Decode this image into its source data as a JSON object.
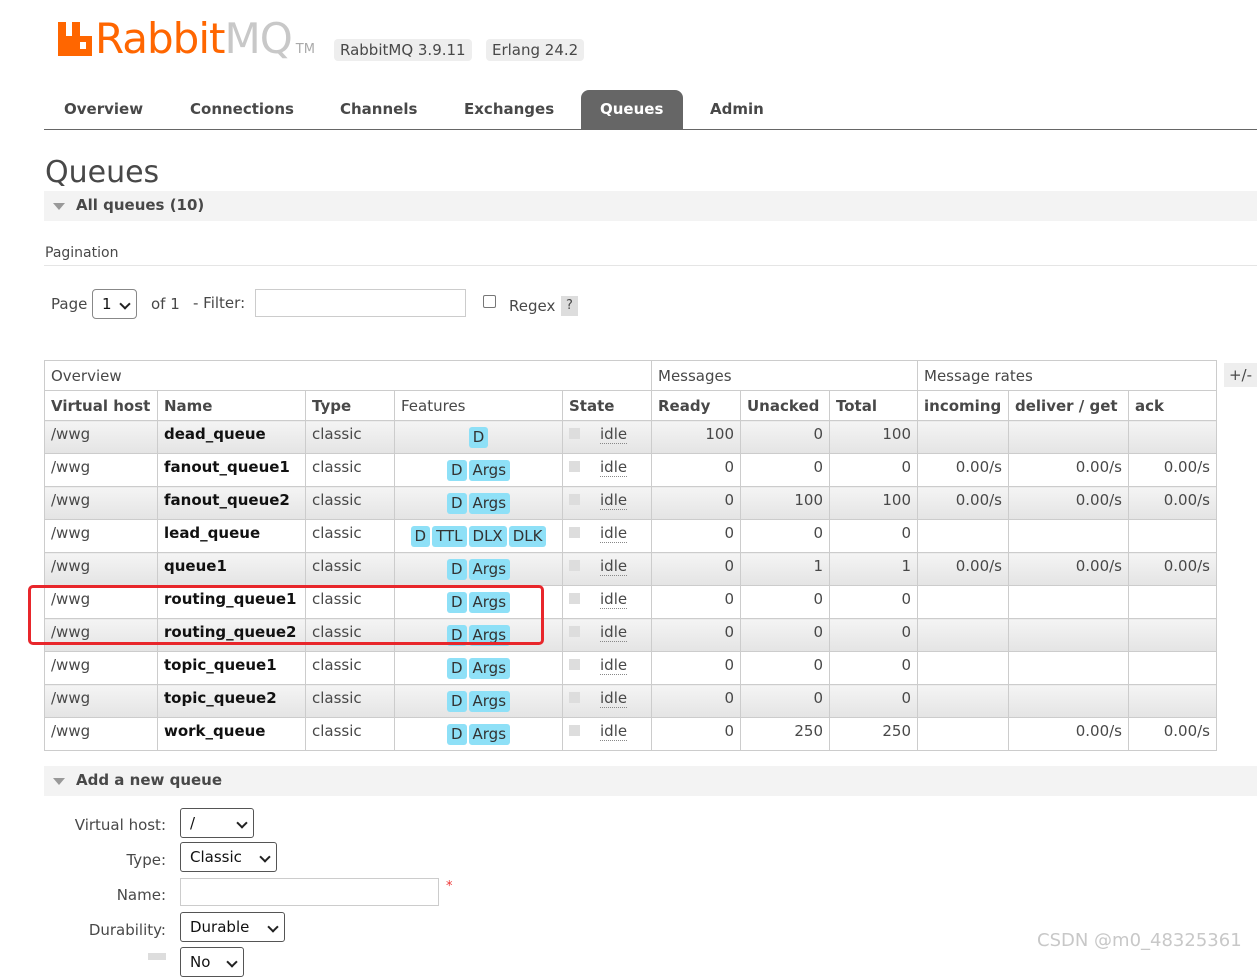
{
  "header": {
    "logo_word_1": "Rabbit",
    "logo_word_2": "MQ",
    "logo_tm": "TM",
    "version_badge": "RabbitMQ 3.9.11",
    "erlang_badge": "Erlang 24.2"
  },
  "nav": {
    "tabs": [
      {
        "label": "Overview",
        "active": false
      },
      {
        "label": "Connections",
        "active": false
      },
      {
        "label": "Channels",
        "active": false
      },
      {
        "label": "Exchanges",
        "active": false
      },
      {
        "label": "Queues",
        "active": true
      },
      {
        "label": "Admin",
        "active": false
      }
    ]
  },
  "page": {
    "title": "Queues",
    "all_queues_label": "All queues (10)",
    "pagination_label": "Pagination"
  },
  "pagination": {
    "page_label": "Page",
    "page_value": "1",
    "of_label": "of 1",
    "filter_label": "- Filter:",
    "filter_value": "",
    "regex_label": "Regex",
    "help_label": "?"
  },
  "table": {
    "group_headers": {
      "overview": "Overview",
      "messages": "Messages",
      "message_rates": "Message rates"
    },
    "columns": {
      "vhost": "Virtual host",
      "name": "Name",
      "type": "Type",
      "features": "Features",
      "state": "State",
      "ready": "Ready",
      "unacked": "Unacked",
      "total": "Total",
      "incoming": "incoming",
      "deliver_get": "deliver / get",
      "ack": "ack"
    },
    "plus_minus": "+/-",
    "rows": [
      {
        "vhost": "/wwg",
        "name": "dead_queue",
        "type": "classic",
        "features": [
          "D"
        ],
        "state": "idle",
        "ready": "100",
        "unacked": "0",
        "total": "100",
        "incoming": "",
        "deliver_get": "",
        "ack": ""
      },
      {
        "vhost": "/wwg",
        "name": "fanout_queue1",
        "type": "classic",
        "features": [
          "D",
          "Args"
        ],
        "state": "idle",
        "ready": "0",
        "unacked": "0",
        "total": "0",
        "incoming": "0.00/s",
        "deliver_get": "0.00/s",
        "ack": "0.00/s"
      },
      {
        "vhost": "/wwg",
        "name": "fanout_queue2",
        "type": "classic",
        "features": [
          "D",
          "Args"
        ],
        "state": "idle",
        "ready": "0",
        "unacked": "100",
        "total": "100",
        "incoming": "0.00/s",
        "deliver_get": "0.00/s",
        "ack": "0.00/s"
      },
      {
        "vhost": "/wwg",
        "name": "lead_queue",
        "type": "classic",
        "features": [
          "D",
          "TTL",
          "DLX",
          "DLK"
        ],
        "state": "idle",
        "ready": "0",
        "unacked": "0",
        "total": "0",
        "incoming": "",
        "deliver_get": "",
        "ack": ""
      },
      {
        "vhost": "/wwg",
        "name": "queue1",
        "type": "classic",
        "features": [
          "D",
          "Args"
        ],
        "state": "idle",
        "ready": "0",
        "unacked": "1",
        "total": "1",
        "incoming": "0.00/s",
        "deliver_get": "0.00/s",
        "ack": "0.00/s"
      },
      {
        "vhost": "/wwg",
        "name": "routing_queue1",
        "type": "classic",
        "features": [
          "D",
          "Args"
        ],
        "state": "idle",
        "ready": "0",
        "unacked": "0",
        "total": "0",
        "incoming": "",
        "deliver_get": "",
        "ack": ""
      },
      {
        "vhost": "/wwg",
        "name": "routing_queue2",
        "type": "classic",
        "features": [
          "D",
          "Args"
        ],
        "state": "idle",
        "ready": "0",
        "unacked": "0",
        "total": "0",
        "incoming": "",
        "deliver_get": "",
        "ack": ""
      },
      {
        "vhost": "/wwg",
        "name": "topic_queue1",
        "type": "classic",
        "features": [
          "D",
          "Args"
        ],
        "state": "idle",
        "ready": "0",
        "unacked": "0",
        "total": "0",
        "incoming": "",
        "deliver_get": "",
        "ack": ""
      },
      {
        "vhost": "/wwg",
        "name": "topic_queue2",
        "type": "classic",
        "features": [
          "D",
          "Args"
        ],
        "state": "idle",
        "ready": "0",
        "unacked": "0",
        "total": "0",
        "incoming": "",
        "deliver_get": "",
        "ack": ""
      },
      {
        "vhost": "/wwg",
        "name": "work_queue",
        "type": "classic",
        "features": [
          "D",
          "Args"
        ],
        "state": "idle",
        "ready": "0",
        "unacked": "250",
        "total": "250",
        "incoming": "",
        "deliver_get": "0.00/s",
        "ack": "0.00/s"
      }
    ]
  },
  "add_queue": {
    "title": "Add a new queue",
    "vhost_label": "Virtual host:",
    "vhost_value": "/",
    "type_label": "Type:",
    "type_value": "Classic",
    "name_label": "Name:",
    "name_value": "",
    "required_mark": "*",
    "durability_label": "Durability:",
    "durability_value": "Durable",
    "next_value": "No"
  },
  "watermark": "CSDN @m0_48325361",
  "colors": {
    "brand": "#ff6600",
    "active_tab": "#666666",
    "feature_badge": "#8ee0f7",
    "highlight": "#e8262b"
  }
}
